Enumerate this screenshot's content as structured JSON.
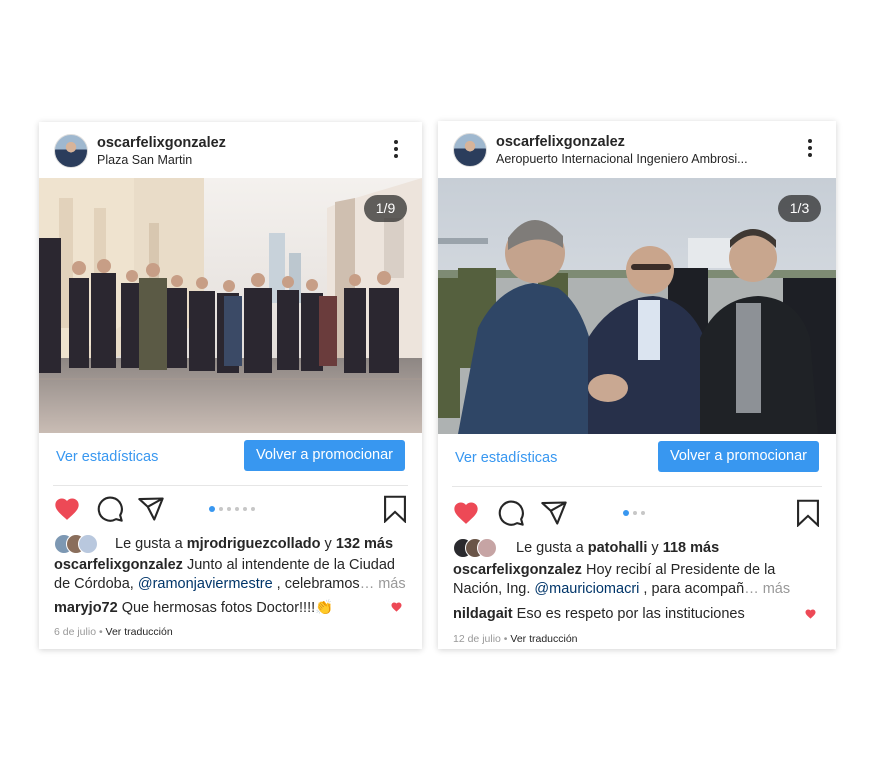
{
  "posts": [
    {
      "username": "oscarfelixgonzalez",
      "location": "Plaza San Martin",
      "counter": "1/9",
      "stats_label": "Ver estadísticas",
      "promote_label": "Volver a promocionar",
      "likes_prefix": "Le gusta a ",
      "likes_user": "mjrodriguezcollado",
      "likes_joiner": " y ",
      "likes_count": "132 más",
      "caption_user": "oscarfelixgonzalez",
      "caption_text_1": "Junto al intendente de la Ciudad de Córdoba, ",
      "caption_mention": "@ramonjaviermestre",
      "caption_text_2": " , celebramos",
      "caption_more": "… más",
      "comment_user": "maryjo72",
      "comment_text": "Que hermosas fotos Doctor!!!!👏",
      "date": "6 de julio",
      "separator": " • ",
      "translate": "Ver traducción",
      "icons": [
        "heart-icon",
        "comment-icon",
        "share-icon",
        "bookmark-icon",
        "more-icon"
      ],
      "carousel_dots": 6,
      "carousel_active": 0
    },
    {
      "username": "oscarfelixgonzalez",
      "location": "Aeropuerto Internacional Ingeniero Ambrosi...",
      "counter": "1/3",
      "stats_label": "Ver estadísticas",
      "promote_label": "Volver a promocionar",
      "likes_prefix": "Le gusta a ",
      "likes_user": "patohalli",
      "likes_joiner": " y ",
      "likes_count": "118 más",
      "caption_user": "oscarfelixgonzalez",
      "caption_text_1": "Hoy recibí al Presidente de la Nación, Ing. ",
      "caption_mention": "@mauriciomacri",
      "caption_text_2": " , para acompañ",
      "caption_more": "… más",
      "comment_user": "nildagait",
      "comment_text": "Eso es respeto por las instituciones",
      "date": "12 de julio",
      "separator": " • ",
      "translate": "Ver traducción",
      "icons": [
        "heart-icon",
        "comment-icon",
        "share-icon",
        "bookmark-icon",
        "more-icon"
      ],
      "carousel_dots": 3,
      "carousel_active": 0
    }
  ],
  "colors": {
    "accent": "#3897f0",
    "like": "#ed4956",
    "text": "#262626",
    "muted": "#999999",
    "mention": "#003569"
  }
}
